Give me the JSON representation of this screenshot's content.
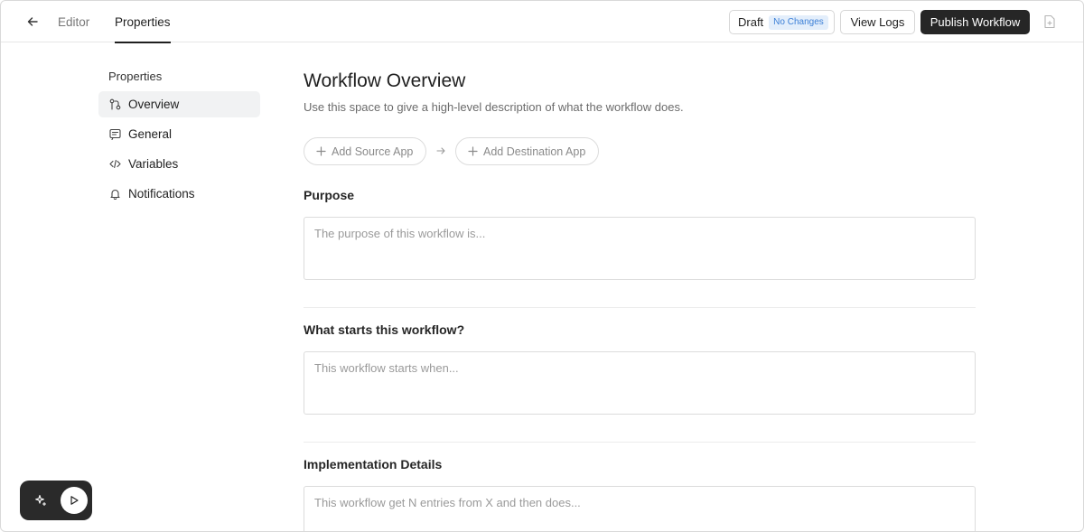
{
  "header": {
    "tabs": [
      {
        "label": "Editor",
        "active": false
      },
      {
        "label": "Properties",
        "active": true
      }
    ],
    "status_label": "Draft",
    "status_badge": "No Changes",
    "view_logs_label": "View Logs",
    "publish_label": "Publish Workflow"
  },
  "sidebar": {
    "heading": "Properties",
    "items": [
      {
        "label": "Overview",
        "icon": "flow-icon",
        "active": true
      },
      {
        "label": "General",
        "icon": "message-icon",
        "active": false
      },
      {
        "label": "Variables",
        "icon": "code-icon",
        "active": false
      },
      {
        "label": "Notifications",
        "icon": "bell-icon",
        "active": false
      }
    ]
  },
  "main": {
    "title": "Workflow Overview",
    "description": "Use this space to give a high-level description of what the workflow does.",
    "add_source_label": "Add Source App",
    "add_destination_label": "Add Destination App",
    "sections": [
      {
        "label": "Purpose",
        "placeholder": "The purpose of this workflow is...",
        "value": ""
      },
      {
        "label": "What starts this workflow?",
        "placeholder": "This workflow starts when...",
        "value": ""
      },
      {
        "label": "Implementation Details",
        "placeholder": "This workflow get N entries from X and then does...",
        "value": ""
      }
    ]
  },
  "colors": {
    "primary_button": "#262626",
    "badge_bg": "#e3eefb",
    "badge_text": "#3b7fd6",
    "active_sidebar_bg": "#f1f2f3"
  }
}
